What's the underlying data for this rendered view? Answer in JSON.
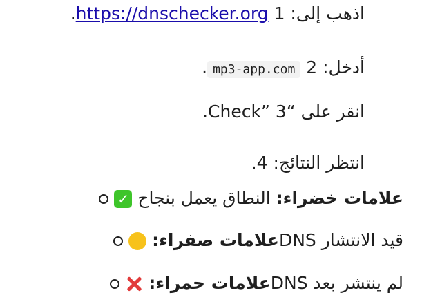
{
  "steps": [
    {
      "number": "1.",
      "text": "اذهب إلى: ",
      "link": "https://dnschecker.org"
    },
    {
      "number": "2.",
      "text": "أدخل: ",
      "code": "mp3-app.com"
    },
    {
      "number": "3.",
      "text": "انقر على “Check”"
    },
    {
      "number": "4.",
      "text": "انتظر النتائج:"
    }
  ],
  "results": [
    {
      "label": "علامات خضراء:",
      "text": " النطاق يعمل بنجاح",
      "icon": "green-check-icon"
    },
    {
      "label": "علامات صفراء:",
      "text": " قيد الانتشار DNS",
      "icon": "yellow-circle-icon"
    },
    {
      "label": "علامات حمراء:",
      "text": " لم ينتشر بعد DNS",
      "icon": "red-cross-icon"
    }
  ]
}
